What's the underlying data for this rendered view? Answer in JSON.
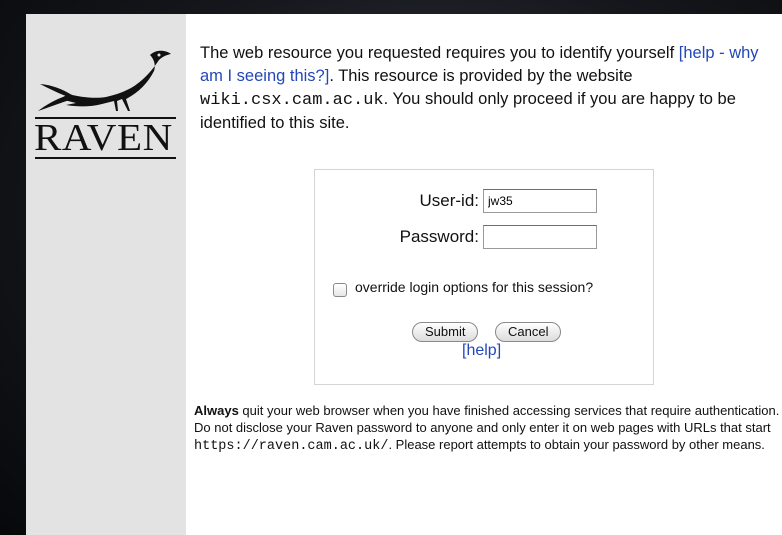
{
  "logo": {
    "text": "RAVEN"
  },
  "intro": {
    "part1": "The web resource you requested requires you to identify yourself ",
    "help_link": "[help - why am I seeing this?]",
    "part2": ". This resource is provided by the website ",
    "site": "wiki.csx.cam.ac.uk",
    "part3": ". You should only proceed if you are happy to be identified to this site."
  },
  "login": {
    "userid_label": "User-id:",
    "userid_value": "jw35",
    "password_label": "Password:",
    "password_value": "",
    "override_label": "override login options for this session?",
    "submit_label": "Submit",
    "cancel_label": "Cancel",
    "help_label": "[help]"
  },
  "footer": {
    "bold": "Always",
    "part1": " quit your web browser when you have finished accessing services that require authentication. Do not disclose your Raven password to anyone and only enter it on web pages with URLs that start ",
    "url": "https://raven.cam.ac.uk/",
    "part2": ". Please report attempts to obtain your password by other means."
  }
}
